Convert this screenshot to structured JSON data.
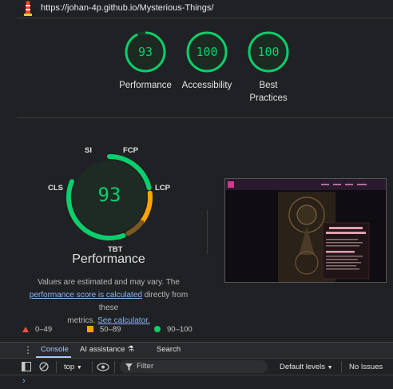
{
  "header": {
    "url": "https://johan-4p.github.io/Mysterious-Things/"
  },
  "top_scores": [
    {
      "value": "93",
      "label": "Performance",
      "fraction": 0.93
    },
    {
      "value": "100",
      "label": "Accessibility",
      "fraction": 1.0
    },
    {
      "value": "100",
      "label_line1": "Best",
      "label_line2": "Practices",
      "fraction": 1.0
    }
  ],
  "performance": {
    "score": "93",
    "title": "Performance",
    "metrics": [
      "SI",
      "FCP",
      "LCP",
      "TBT",
      "CLS"
    ],
    "note_line1": "Values are estimated and may vary. The",
    "note_link1": "performance score is calculated",
    "note_line2_rest": " directly from these",
    "note_line3": "metrics.",
    "note_link2": "See calculator."
  },
  "legend": [
    {
      "shape": "triangle",
      "label": "0–49",
      "color": "#ff4e42"
    },
    {
      "shape": "square",
      "label": "50–89",
      "color": "#ffa400"
    },
    {
      "shape": "circle",
      "label": "90–100",
      "color": "#0cce6b"
    }
  ],
  "drawer": {
    "tabs": [
      "Console",
      "AI assistance",
      "Search"
    ],
    "toolbar": {
      "context": "top",
      "filter_placeholder": "Filter",
      "levels": "Default levels",
      "issues": "No Issues"
    },
    "prompt": "›"
  },
  "colors": {
    "pass": "#0cce6b",
    "average": "#ffa400",
    "fail": "#ff4e42",
    "link": "#8ab4f8"
  }
}
